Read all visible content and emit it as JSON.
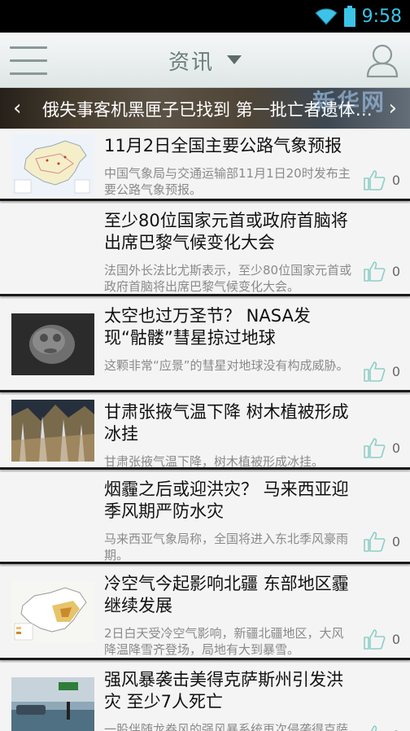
{
  "status_bar": {
    "time": "9:58",
    "accent_color": "#3cc3e8"
  },
  "app_bar": {
    "title": "资讯",
    "menu_icon": "hamburger-menu-icon",
    "dropdown_icon": "caret-down-icon",
    "profile_icon": "user-profile-icon"
  },
  "banner": {
    "headline": "俄失事客机黑匣子已找到 第一批亡者遗体运抵",
    "watermark": "新华网",
    "prev_icon": "chevron-left-icon",
    "next_icon": "chevron-right-icon"
  },
  "news": [
    {
      "title": "11月2日全国主要公路气象预报",
      "summary": "中国气象局与交通运输部11月1日20时发布主要公路气象预报。",
      "likes": "0",
      "thumbnail": "china-map-thumbnail"
    },
    {
      "title": "至少80位国家元首或政府首脑将出席巴黎气候变化大会",
      "summary": "法国外长法比尤斯表示，至少80位国家元首或政府首脑将出席巴黎气候变化大会。",
      "likes": "0",
      "thumbnail": ""
    },
    {
      "title": "太空也过万圣节？ NASA发现“骷髅”彗星掠过地球",
      "summary": "这颗非常“应景”的彗星对地球没有构成威胁。",
      "likes": "0",
      "thumbnail": "comet-thumbnail"
    },
    {
      "title": "甘肃张掖气温下降 树木植被形成冰挂",
      "summary": "甘肃张掖气温下降，树木植被形成冰挂。",
      "likes": "0",
      "thumbnail": "icy-trees-thumbnail"
    },
    {
      "title": "烟霾之后或迎洪灾？ 马来西亚迎季风期严防水灾",
      "summary": "马来西亚气象局称，全国将进入东北季风豪雨期。",
      "likes": "0",
      "thumbnail": ""
    },
    {
      "title": "冷空气今起影响北疆 东部地区霾继续发展",
      "summary": "2日白天受冷空气影响，新疆北疆地区，大风降温降雪齐登场，局地有大到暴雪。",
      "likes": "0",
      "thumbnail": "weather-map-thumbnail"
    },
    {
      "title": "强风暴袭击美得克萨斯州引发洪灾 至少7人死亡",
      "summary": "一股伴随龙卷风的强风暴系统再次侵袭得克萨斯州。",
      "likes": "0",
      "thumbnail": "flood-thumbnail"
    }
  ]
}
